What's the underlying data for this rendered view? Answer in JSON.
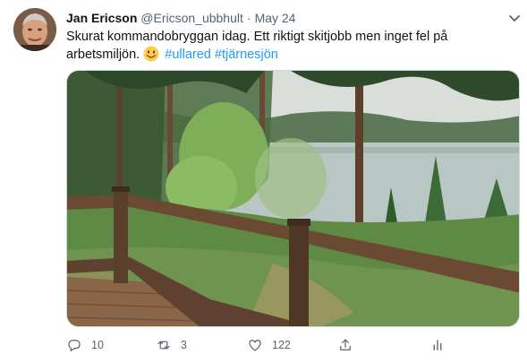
{
  "tweet": {
    "author_name": "Jan Ericson",
    "handle": "@Ericson_ubbhult",
    "separator": "·",
    "date": "May 24",
    "text_line1": "Skurat kommandobryggan idag. Ett riktigt skitjobb men inget fel på",
    "text_line2": "arbetsmiljön.",
    "hashtags": [
      "#ullared",
      "#tjärnesjön"
    ],
    "emoji": "smiling-face-emoji"
  },
  "actions": {
    "reply_count": "10",
    "retweet_count": "3",
    "like_count": "122"
  },
  "icons": {
    "reply": "reply-icon",
    "retweet": "retweet-icon",
    "like": "like-icon",
    "share": "share-icon",
    "analytics": "analytics-icon",
    "more": "chevron-down-icon"
  },
  "colors": {
    "link": "#1d9bf0",
    "text": "#0f1419",
    "secondary": "#536471"
  }
}
